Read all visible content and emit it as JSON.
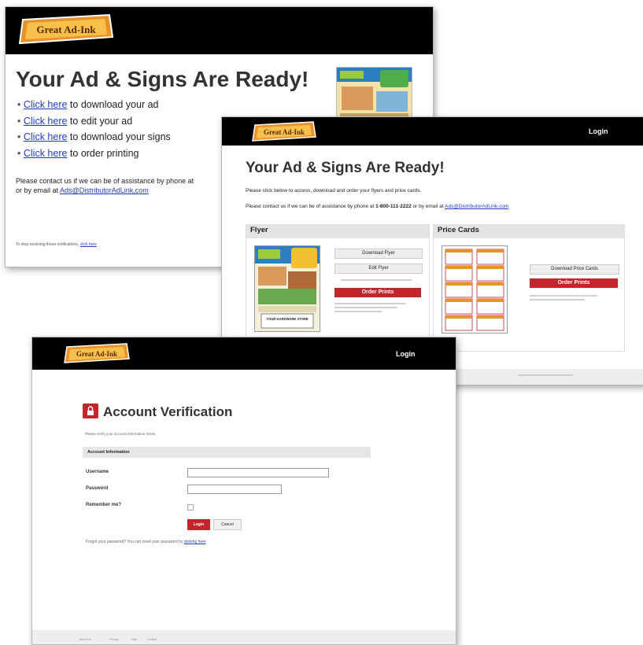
{
  "colors": {
    "header_bg": "#000000",
    "accent_red": "#c4242b",
    "link_blue": "#1f3fbf",
    "logo_orange": "#e9912b"
  },
  "logo": {
    "text": "Great Ad-Ink",
    "icon": "brand-logo"
  },
  "window1": {
    "title": "Your Ad & Signs Are Ready!",
    "items": [
      {
        "link": "Click here",
        "text": "to download your ad"
      },
      {
        "link": "Click here",
        "text": "to edit your ad"
      },
      {
        "link": "Click here",
        "text": "to download your signs"
      },
      {
        "link": "Click here",
        "text": "to order printing"
      }
    ],
    "contact_line1": "Please contact us if we can be of assistance by phone at",
    "contact_line2_prefix": "or by email at",
    "email": "Ads@DistributorAdLink.com",
    "stop_text": "To stop receiving these notifications,",
    "stop_link": "click here"
  },
  "window2": {
    "login": "Login",
    "title": "Your Ad & Signs Are Ready!",
    "intro": "Please click below to access, download and order your flyers and price cards.",
    "contact_prefix": "Please contact us if we can be of assistance by phone at",
    "phone": "1-800-111-2222",
    "contact_mid": "or by email at",
    "email": "Ads@DistributorAdLink.com",
    "flyer": {
      "heading": "Flyer",
      "download": "Download Flyer",
      "edit": "Edit Flyer",
      "order": "Order Prints",
      "store": "YOUR HARDWARE STORE"
    },
    "price_cards": {
      "heading": "Price Cards",
      "download": "Download Price Cards",
      "order": "Order Prints"
    }
  },
  "window3": {
    "login": "Login",
    "title": "Account Verification",
    "intro": "Please verify your account information below.",
    "section": "Account Information",
    "username_label": "Username",
    "password_label": "Password",
    "remember_label": "Remember me?",
    "login_button": "Login",
    "cancel_button": "Cancel",
    "forgot_text": "Forgot your password? You can reset your password by",
    "forgot_link": "clicking here",
    "footer_links": [
      "About Us",
      "Privacy",
      "Help",
      "Contact"
    ]
  }
}
